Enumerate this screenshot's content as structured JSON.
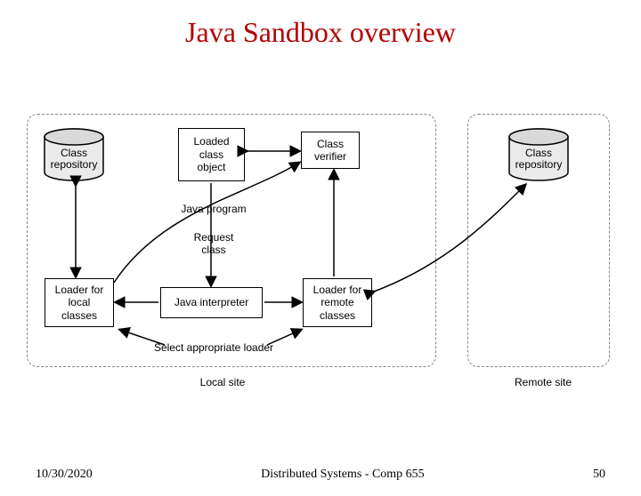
{
  "title": "Java Sandbox overview",
  "footer": {
    "date": "10/30/2020",
    "center": "Distributed Systems - Comp 655",
    "page": "50"
  },
  "diagram": {
    "local_label": "Local site",
    "remote_label": "Remote site",
    "class_repo_local": "Class\nrepository",
    "class_repo_remote": "Class\nrepository",
    "loaded_class_object": "Loaded\nclass\nobject",
    "class_verifier": "Class\nverifier",
    "java_program": "Java program",
    "request_class": "Request\nclass",
    "loader_local": "Loader for\nlocal\nclasses",
    "java_interpreter": "Java interpreter",
    "loader_remote": "Loader for\nremote\nclasses",
    "select_loader": "Select appropriate loader"
  }
}
